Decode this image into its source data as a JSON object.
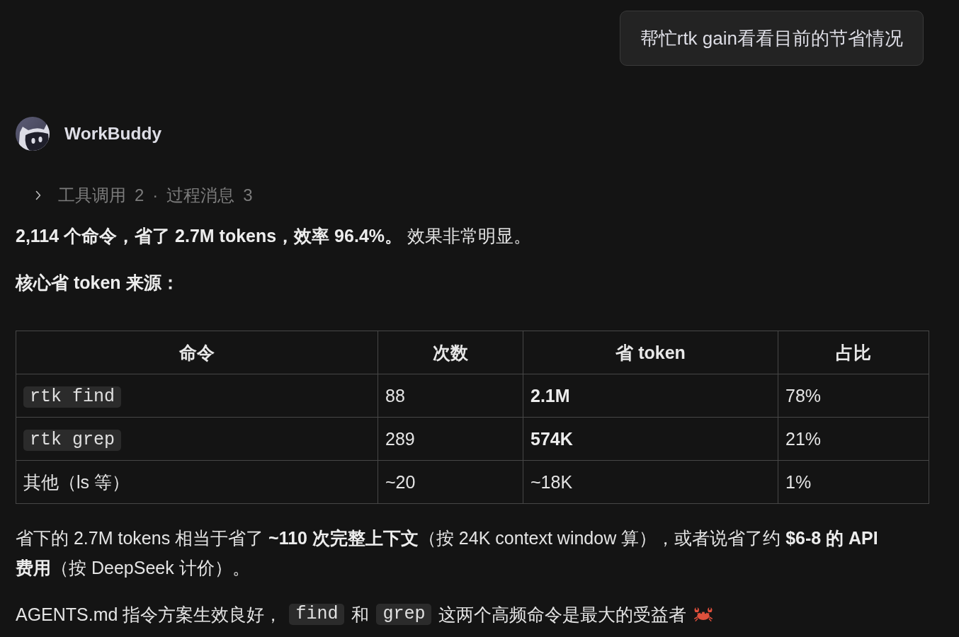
{
  "user_message": {
    "text": "帮忙rtk gain看看目前的节省情况"
  },
  "assistant": {
    "name": "WorkBuddy"
  },
  "activity": {
    "expanded": false,
    "separator": "·",
    "items": [
      {
        "label": "工具调用",
        "count": "2"
      },
      {
        "label": "过程消息",
        "count": "3"
      }
    ]
  },
  "content": [
    {
      "kind": "paragraph",
      "text": "**2,114 个命令，省了 2.7M tokens，效率 96.4%。** 效果非常明显。"
    },
    {
      "kind": "heading",
      "text": "核心省 token 来源："
    },
    {
      "kind": "table",
      "columns": [
        "命令",
        "次数",
        "省 token",
        "占比"
      ],
      "rows": [
        [
          {
            "kind": "code",
            "text": "rtk find"
          },
          {
            "kind": "text",
            "text": "88"
          },
          {
            "kind": "bold",
            "text": "2.1M"
          },
          {
            "kind": "text",
            "text": "78%"
          }
        ],
        [
          {
            "kind": "code",
            "text": "rtk grep"
          },
          {
            "kind": "text",
            "text": "289"
          },
          {
            "kind": "bold",
            "text": "574K"
          },
          {
            "kind": "text",
            "text": "21%"
          }
        ],
        [
          {
            "kind": "text",
            "text": "其他（ls 等）"
          },
          {
            "kind": "text",
            "text": "~20"
          },
          {
            "kind": "text",
            "text": "~18K"
          },
          {
            "kind": "text",
            "text": "1%"
          }
        ]
      ]
    },
    {
      "kind": "paragraph",
      "text": "省下的 2.7M tokens 相当于省了 **~110 次完整上下文**（按 24K context window 算），或者说省了约 **$6-8 的 API 费用**（按 DeepSeek 计价）。"
    },
    {
      "kind": "segments",
      "trailing_icon": true,
      "segments": [
        {
          "kind": "text",
          "text": "AGENTS.md 指令方案生效良好，"
        },
        {
          "kind": "code",
          "text": "find"
        },
        {
          "kind": "text",
          "text": "和"
        },
        {
          "kind": "code",
          "text": "grep"
        },
        {
          "kind": "text",
          "text": "这两个高频命令是最大的受益者"
        }
      ]
    }
  ]
}
